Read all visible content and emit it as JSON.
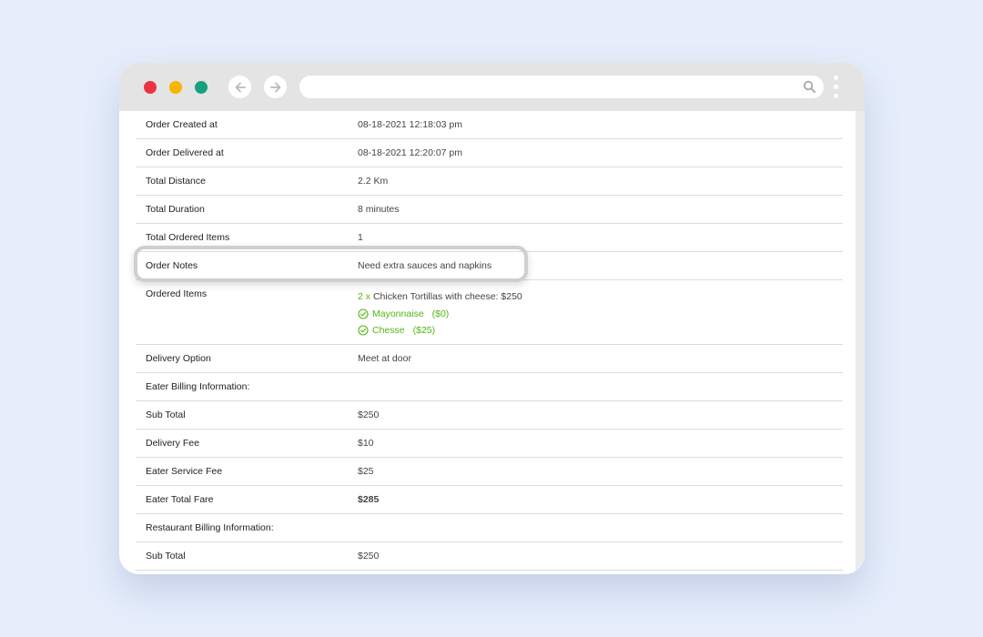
{
  "browser": {
    "address_value": "",
    "icons": [
      "arrow-left-icon",
      "arrow-right-icon",
      "search-icon",
      "kebab-menu-icon"
    ]
  },
  "colors": {
    "close_dot": "#ec3340",
    "minimize_dot": "#f7b500",
    "maximize_dot": "#17a27d",
    "accent_green": "#54b514",
    "background": "#e6eefc"
  },
  "order": {
    "rows": [
      {
        "label": "Order Created at",
        "value": "08-18-2021 12:18:03 pm"
      },
      {
        "label": "Order Delivered at",
        "value": "08-18-2021 12:20:07 pm"
      },
      {
        "label": "Total Distance",
        "value": "2.2 Km"
      },
      {
        "label": "Total Duration",
        "value": "8 minutes"
      },
      {
        "label": "Total Ordered Items",
        "value": "1"
      },
      {
        "label": "Order Notes",
        "value": "Need extra sauces and napkins"
      }
    ],
    "ordered_items": {
      "label": "Ordered Items",
      "qty": "2 x",
      "item": "Chicken Tortillas with cheese: $250",
      "addons": [
        {
          "name": "Mayonnaise",
          "price": "($0)"
        },
        {
          "name": "Chesse",
          "price": "($25)"
        }
      ]
    },
    "rows2": [
      {
        "label": "Delivery Option",
        "value": "Meet at door"
      },
      {
        "label": "Eater Billing Information:",
        "value": ""
      },
      {
        "label": "Sub Total",
        "value": "$250"
      },
      {
        "label": "Delivery Fee",
        "value": "$10"
      },
      {
        "label": "Eater Service Fee",
        "value": "$25"
      },
      {
        "label": "Eater Total Fare",
        "value": "$285"
      },
      {
        "label": "Restaurant Billing Information:",
        "value": ""
      },
      {
        "label": "Sub Total",
        "value": "$250"
      }
    ]
  }
}
